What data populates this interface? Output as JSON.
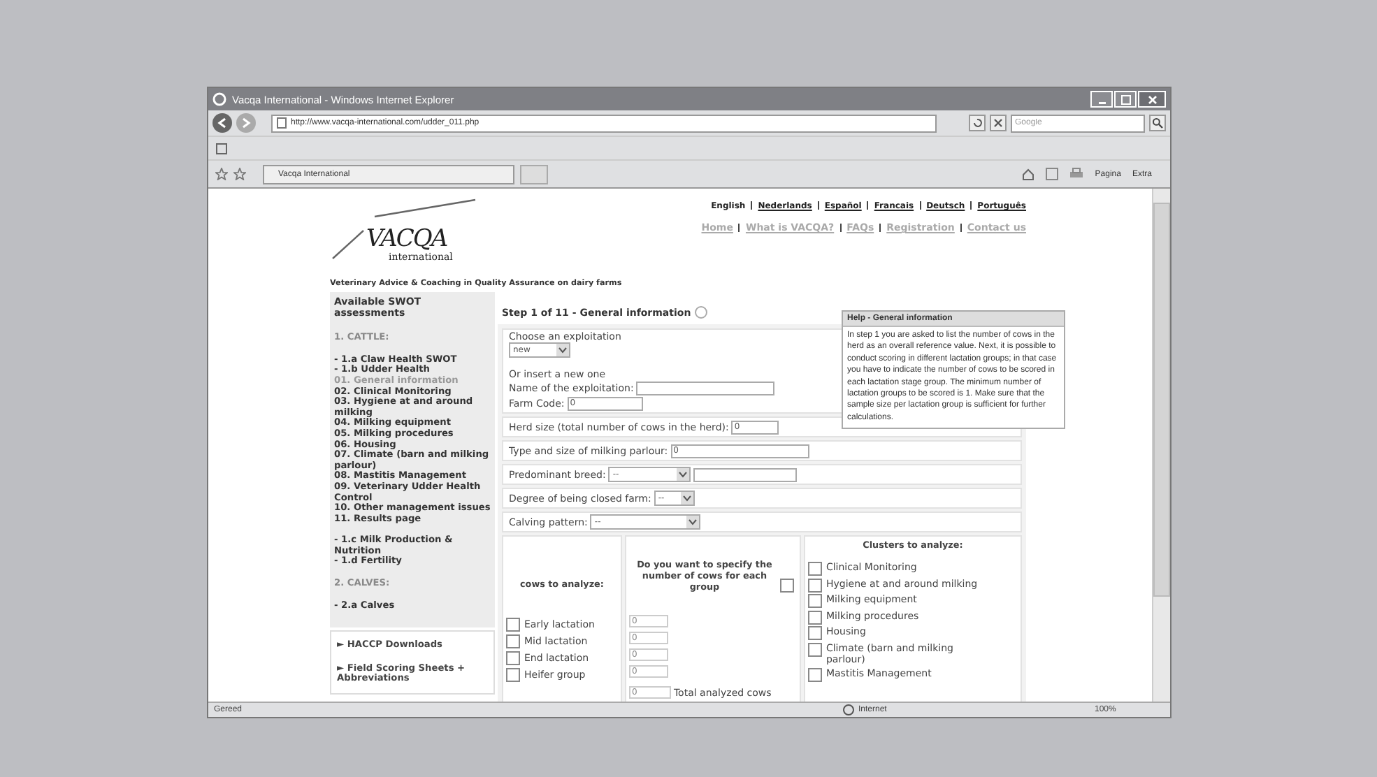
{
  "window": {
    "title": "Vacqa International - Windows Internet Explorer"
  },
  "address_bar": {
    "url": "http://www.vacqa-international.com/udder_011.php"
  },
  "search": {
    "placeholder": "Google"
  },
  "tab": {
    "title": "Vacqa International"
  },
  "command_bar": [
    {
      "label": "Pagina"
    },
    {
      "label": "Extra"
    }
  ],
  "header": {
    "logo": "VACQA",
    "logo_sub": "international",
    "tagline": "Veterinary Advice & Coaching in Quality Assurance on dairy farms",
    "languages": [
      {
        "label": "English",
        "selected": true
      },
      {
        "label": "Nederlands",
        "selected": false
      },
      {
        "label": "Español",
        "selected": false
      },
      {
        "label": "Francais",
        "selected": false
      },
      {
        "label": "Deutsch",
        "selected": false
      },
      {
        "label": "Português",
        "selected": false
      }
    ],
    "links": [
      "Home",
      "What is VACQA?",
      "FAQs",
      "Registration",
      "Contact us"
    ]
  },
  "sidebar": {
    "title": "Available SWOT assessments",
    "sections": [
      {
        "heading": "1. CATTLE:",
        "items": [
          {
            "label": "- 1.a Claw Health SWOT"
          },
          {
            "label": "- 1.b Udder Health",
            "children": [
              {
                "label": "01. General information",
                "selected": true
              },
              {
                "label": "02. Clinical Monitoring",
                "selected": false
              },
              {
                "label": "03. Hygiene at and around milking",
                "selected": false
              },
              {
                "label": "04. Milking equipment",
                "selected": false
              },
              {
                "label": "05. Milking procedures",
                "selected": false
              },
              {
                "label": "06. Housing",
                "selected": false
              },
              {
                "label": "07. Climate (barn and milking parlour)",
                "selected": false
              },
              {
                "label": "08. Mastitis Management",
                "selected": false
              },
              {
                "label": "09. Veterinary Udder Health Control",
                "selected": false
              },
              {
                "label": "10. Other management issues",
                "selected": false
              },
              {
                "label": "11. Results page",
                "selected": false
              }
            ]
          },
          {
            "label": "- 1.c Milk Production & Nutrition"
          },
          {
            "label": "- 1.d Fertility"
          }
        ]
      },
      {
        "heading": "2. CALVES:",
        "items": [
          {
            "label": "- 2.a Calves"
          }
        ]
      }
    ],
    "downloads": [
      "► HACCP Downloads",
      "► Field Scoring Sheets + Abbreviations"
    ]
  },
  "form": {
    "title": "Step 1 of 11 - General information",
    "exploitation": {
      "label": "Choose an exploitation",
      "value": "new"
    },
    "insert_label": "Or insert a new one",
    "name": {
      "label": "Name of the exploitation:"
    },
    "farm_code": {
      "label": "Farm Code:",
      "value": "0"
    },
    "herd_size": {
      "label": "Herd size (total number of cows in the herd):",
      "value": "0"
    },
    "parlour": {
      "label": "Type and size of milking parlour:",
      "value": "0"
    },
    "breed": {
      "label": "Predominant breed:",
      "value": "--"
    },
    "closed_farm": {
      "label": "Degree of being closed farm:",
      "value": "--"
    },
    "calving": {
      "label": "Calving pattern:",
      "value": "--"
    },
    "lactation": {
      "heading": "cows to analyze:",
      "groups": [
        {
          "label": "Early lactation",
          "checked": false,
          "count": "0"
        },
        {
          "label": "Mid lactation",
          "checked": false,
          "count": "0"
        },
        {
          "label": "End lactation",
          "checked": false,
          "count": "0"
        },
        {
          "label": "Heifer group",
          "checked": false,
          "count": "0"
        }
      ]
    },
    "specify": {
      "label": "Do you want to specify the number of cows for each group",
      "checked": false
    },
    "total": {
      "value": "0",
      "label": "Total analyzed cows"
    },
    "clusters": {
      "heading": "Clusters to analyze:",
      "items": [
        {
          "label": "Clinical Monitoring",
          "checked": false
        },
        {
          "label": "Hygiene at and around milking",
          "checked": false
        },
        {
          "label": "Milking equipment",
          "checked": false
        },
        {
          "label": "Milking procedures",
          "checked": false
        },
        {
          "label": "Housing",
          "checked": false
        },
        {
          "label": "Climate (barn and milking parlour)",
          "checked": false
        },
        {
          "label": "Mastitis Management",
          "checked": false
        }
      ]
    }
  },
  "help": {
    "title": "Help - General information",
    "text": "In step 1 you are asked to list the number of cows in the herd as an overall reference value. Next, it is possible to conduct scoring in different lactation groups; in that case you have to indicate the number of cows to be scored in each lactation stage group. The minimum number of lactation groups to be scored is 1. Make sure that the sample size per lactation group is sufficient  for further calculations."
  },
  "status_bar": {
    "status": "Gereed",
    "zone": "Internet",
    "zoom": "100%"
  }
}
